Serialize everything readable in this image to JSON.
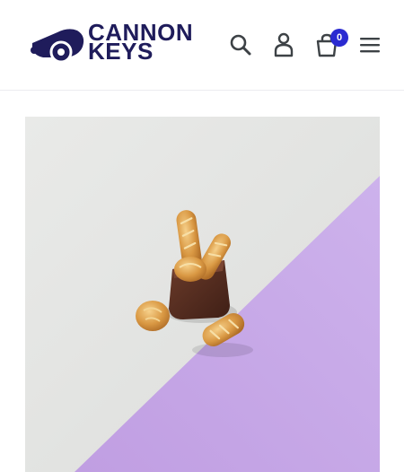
{
  "header": {
    "logo": {
      "line1": "CANNON",
      "line2": "KEYS"
    },
    "icons": {
      "search": "search-icon",
      "account": "account-icon",
      "cart": "cart-icon",
      "menu": "hamburger-menu-icon"
    },
    "cart_count": "0"
  },
  "colors": {
    "brand_navy": "#1f1c5b",
    "cart_badge": "#2a2ad1",
    "icon": "#3d4246",
    "image_lilac": "#c7a9e6",
    "image_grey": "#e6e7e5"
  },
  "product": {
    "image": "bread-keycaps-photo"
  }
}
